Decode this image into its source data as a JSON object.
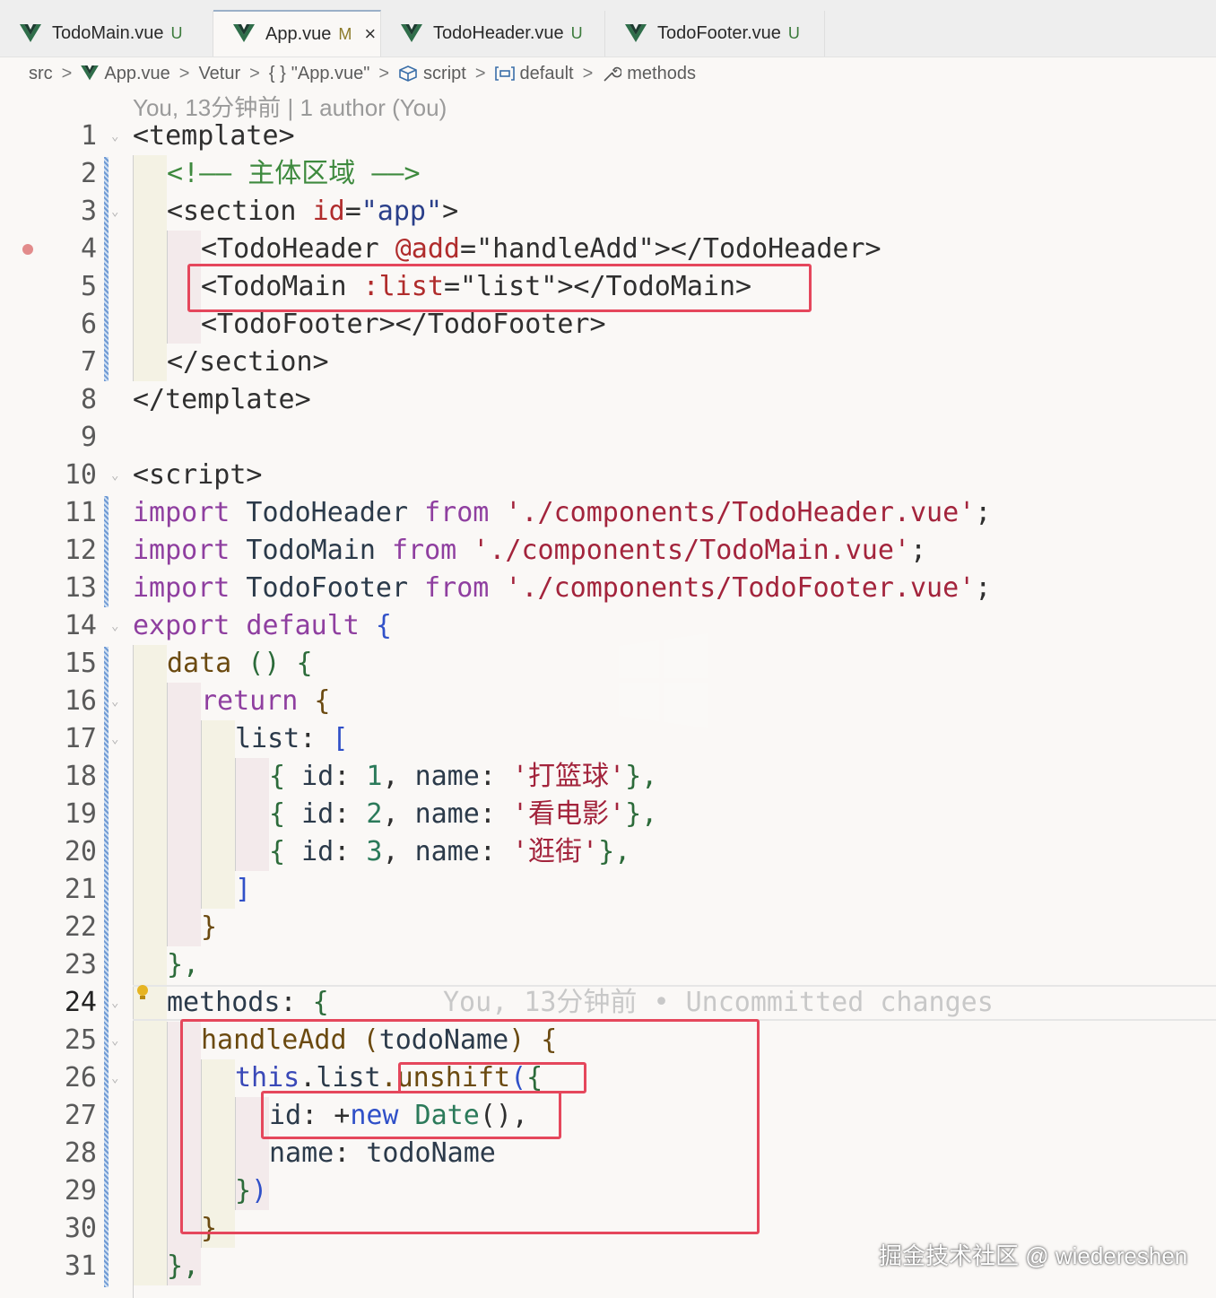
{
  "tabs": [
    {
      "name": "TodoMain.vue",
      "status": "U"
    },
    {
      "name": "App.vue",
      "status": "M",
      "close": "×"
    },
    {
      "name": "TodoHeader.vue",
      "status": "U"
    },
    {
      "name": "TodoFooter.vue",
      "status": "U"
    }
  ],
  "breadcrumb": {
    "src": "src",
    "file": "App.vue",
    "vetur": "Vetur",
    "braces": "{ }",
    "vetur_file": "\"App.vue\"",
    "script": "script",
    "default": "default",
    "methods": "methods",
    "sep": ">"
  },
  "blame_header": "You, 13分钟前 | 1 author (You)",
  "blame_inline": "You, 13分钟前 • Uncommitted changes",
  "line_numbers": [
    "1",
    "2",
    "3",
    "4",
    "5",
    "6",
    "7",
    "8",
    "9",
    "10",
    "11",
    "12",
    "13",
    "14",
    "15",
    "16",
    "17",
    "18",
    "19",
    "20",
    "21",
    "22",
    "23",
    "24",
    "25",
    "26",
    "27",
    "28",
    "29",
    "30",
    "31"
  ],
  "watermark": "掘金技术社区 @ wiedereshen",
  "code": {
    "l1": {
      "a": "<template>"
    },
    "l2": {
      "a": "<!—— 主体区域 ——>"
    },
    "l3": {
      "a": "<section ",
      "b": "id",
      "c": "=",
      "d": "\"app\"",
      "e": ">"
    },
    "l4": {
      "a": "<TodoHeader ",
      "b": "@add",
      "c": "=",
      "d": "\"handleAdd\"",
      "e": "></TodoHeader>"
    },
    "l5": {
      "a": "<TodoMain ",
      "b": ":list",
      "c": "=",
      "d": "\"list\"",
      "e": "></TodoMain>"
    },
    "l6": {
      "a": "<TodoFooter></TodoFooter>"
    },
    "l7": {
      "a": "</section>"
    },
    "l8": {
      "a": "</template>"
    },
    "l10": {
      "a": "<script>"
    },
    "l11": {
      "kw": "import",
      "id": " TodoHeader ",
      "from": "from",
      "str": " './components/TodoHeader.vue'",
      "semi": ";"
    },
    "l12": {
      "kw": "import",
      "id": " TodoMain ",
      "from": "from",
      "str": " './components/TodoMain.vue'",
      "semi": ";"
    },
    "l13": {
      "kw": "import",
      "id": " TodoFooter ",
      "from": "from",
      "str": " './components/TodoFooter.vue'",
      "semi": ";"
    },
    "l14": {
      "kw": "export default",
      "br": " {"
    },
    "l15": {
      "fn": "data",
      "p": " ()",
      "br": " {"
    },
    "l16": {
      "kw": "return",
      "br": " {"
    },
    "l17": {
      "id": "list",
      "p": ": ",
      "br": "["
    },
    "l18": {
      "br": "{",
      "k1": " id",
      "p1": ": ",
      "n": "1",
      "p2": ", ",
      "k2": "name",
      "p3": ": ",
      "s": "'打篮球'",
      "end": "},"
    },
    "l19": {
      "br": "{",
      "k1": " id",
      "p1": ": ",
      "n": "2",
      "p2": ", ",
      "k2": "name",
      "p3": ": ",
      "s": "'看电影'",
      "end": "},"
    },
    "l20": {
      "br": "{",
      "k1": " id",
      "p1": ": ",
      "n": "3",
      "p2": ", ",
      "k2": "name",
      "p3": ": ",
      "s": "'逛街'",
      "end": "},"
    },
    "l21": {
      "br": "]"
    },
    "l22": {
      "br": "}"
    },
    "l23": {
      "br": "},"
    },
    "l24": {
      "id": "methods",
      "p": ": ",
      "br": "{"
    },
    "l25": {
      "fn": "handleAdd",
      "p": " (",
      "arg": "todoName",
      "p2": ")",
      "br": " {"
    },
    "l26": {
      "th": "this",
      "p": ".",
      "id": "list",
      "fn": ".unshift",
      "br": "(",
      "br2": "{"
    },
    "l27": {
      "k": "id",
      "p": ": +",
      "kw": "new",
      "cls": " Date",
      "p2": "(),"
    },
    "l28": {
      "k": "name",
      "p": ": ",
      "v": "todoName"
    },
    "l29": {
      "br": "}",
      "br2": ")"
    },
    "l30": {
      "br": "}"
    },
    "l31": {
      "br": "},"
    }
  }
}
